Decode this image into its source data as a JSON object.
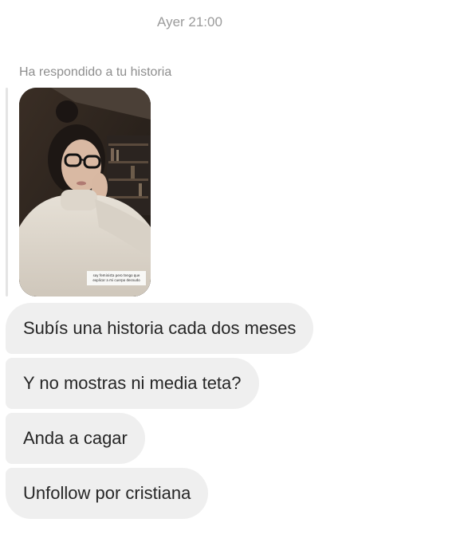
{
  "timestamp": "Ayer 21:00",
  "reply": {
    "label": "Ha respondido a tu historia",
    "story_caption": "soy feminista pero tengo que explicar a mi cuerpo desnudo"
  },
  "messages": [
    {
      "text": "Subís una historia cada dos meses"
    },
    {
      "text": "Y no mostras ni media teta?"
    },
    {
      "text": "Anda a cagar"
    },
    {
      "text": "Unfollow por cristiana"
    }
  ],
  "colors": {
    "bubble_bg": "#efefef",
    "text": "#262626",
    "muted": "#8e8e8e"
  }
}
